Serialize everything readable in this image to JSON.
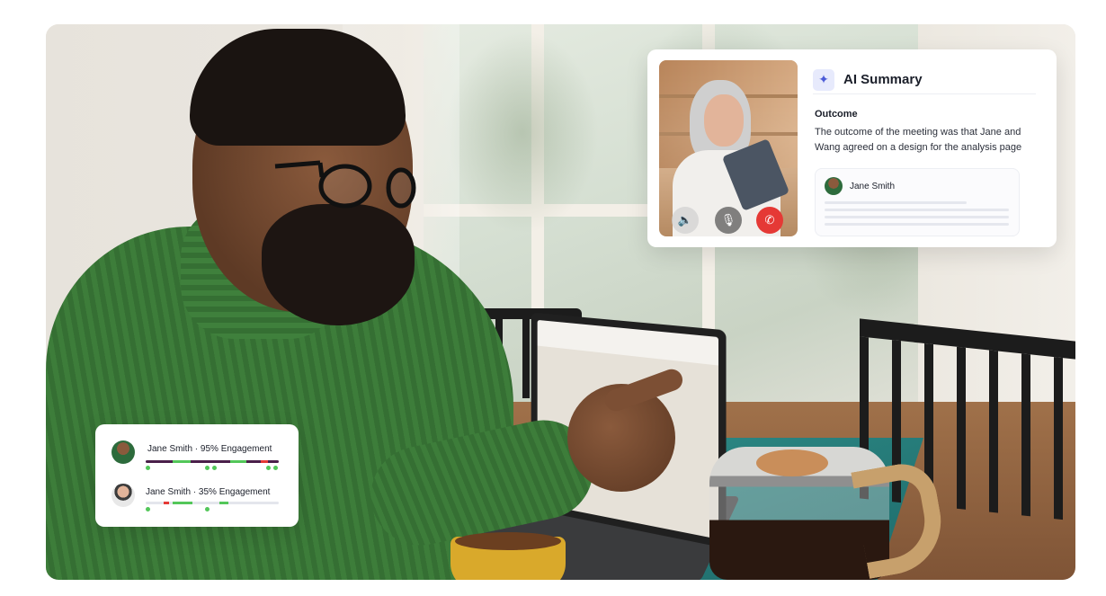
{
  "ai_summary": {
    "title": "AI Summary",
    "icon": "magic-wand-icon",
    "outcome_label": "Outcome",
    "outcome_text": "The outcome of the meeting was that Jane and Wang agreed on a design for the analysis page",
    "transcript_speaker": "Jane Smith",
    "accent_color": "#4b5bd7"
  },
  "call_controls": {
    "speaker_icon": "speaker-icon",
    "mic_icon": "microphone-icon",
    "end_call_icon": "phone-hangup-icon",
    "end_call_color": "#e53935"
  },
  "engagement": {
    "rows": [
      {
        "label": "Jane Smith · 95% Engagement",
        "engagement_percent": 95
      },
      {
        "label": "Jane Smith · 35% Engagement",
        "engagement_percent": 35
      }
    ],
    "colors": {
      "talk": "#4a1f4a",
      "active": "#53c75a",
      "interrupt": "#e53935"
    }
  }
}
